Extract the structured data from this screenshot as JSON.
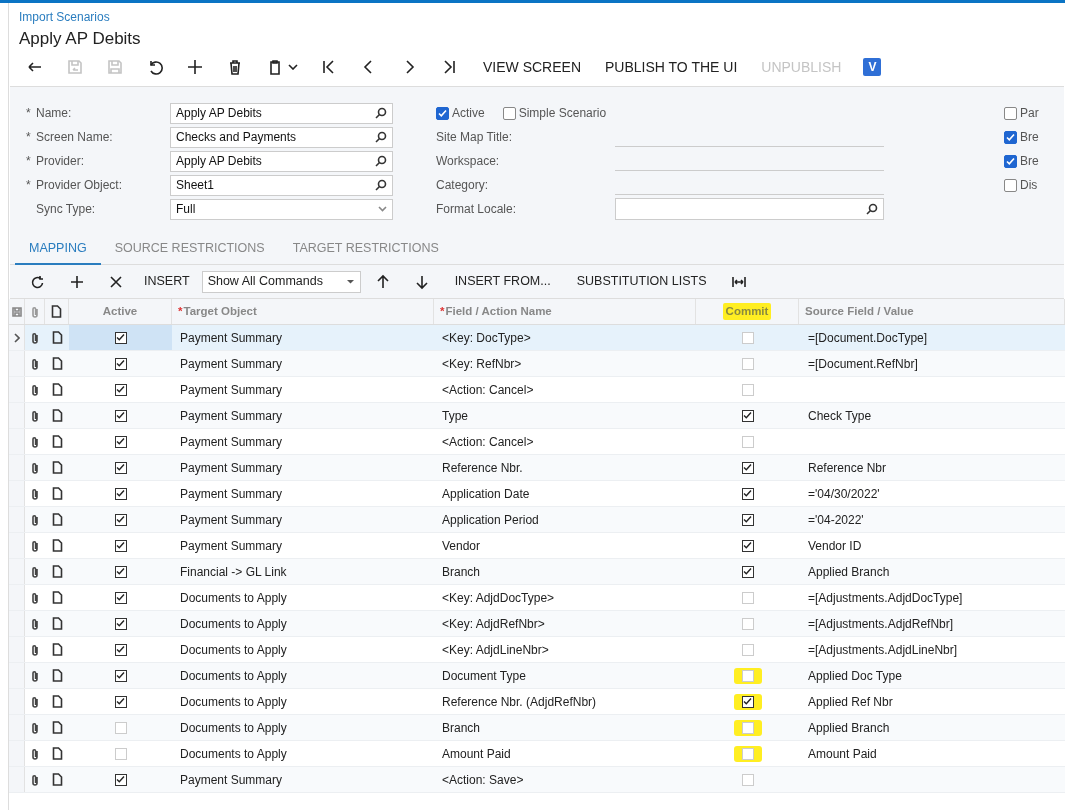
{
  "breadcrumb": "Import Scenarios",
  "title": "Apply AP Debits",
  "toolbar": {
    "icon_buttons": [
      {
        "kind": "back",
        "disabled": false
      },
      {
        "kind": "save-close",
        "disabled": true
      },
      {
        "kind": "save",
        "disabled": true
      },
      {
        "kind": "undo",
        "disabled": false
      },
      {
        "kind": "add",
        "disabled": false
      },
      {
        "kind": "delete",
        "disabled": false
      },
      {
        "kind": "clipboard",
        "disabled": false
      },
      {
        "kind": "first",
        "disabled": false
      },
      {
        "kind": "prev",
        "disabled": false
      },
      {
        "kind": "next",
        "disabled": false
      },
      {
        "kind": "last",
        "disabled": false
      }
    ],
    "text_buttons": [
      {
        "label": "VIEW SCREEN",
        "disabled": false
      },
      {
        "label": "PUBLISH TO THE UI",
        "disabled": false
      },
      {
        "label": "UNPUBLISH",
        "disabled": true
      }
    ],
    "badge": "V"
  },
  "form": {
    "left_fields": [
      {
        "marker": "*",
        "label": "Name:",
        "value": "Apply AP Debits",
        "kind": "lookup"
      },
      {
        "marker": "*",
        "label": "Screen Name:",
        "value": "Checks and Payments",
        "kind": "lookup"
      },
      {
        "marker": "*",
        "label": "Provider:",
        "value": "Apply AP Debits",
        "kind": "lookup"
      },
      {
        "marker": "*",
        "label": "Provider Object:",
        "value": "Sheet1",
        "kind": "lookup"
      },
      {
        "label": "Sync Type:",
        "value": "Full",
        "kind": "select"
      }
    ],
    "checkboxes": [
      {
        "label": "Active",
        "checked": true
      },
      {
        "label": "Simple Scenario",
        "checked": false
      }
    ],
    "middle_fields": [
      {
        "label": "Site Map Title:",
        "kind": "line"
      },
      {
        "label": "Workspace:",
        "kind": "line"
      },
      {
        "label": "Category:",
        "kind": "line"
      },
      {
        "label": "Format Locale:",
        "kind": "lookup"
      }
    ],
    "right_checkboxes": [
      {
        "label": "Par",
        "checked": false
      },
      {
        "label": "Bre",
        "checked": true
      },
      {
        "label": "Bre",
        "checked": true
      },
      {
        "label": "Dis",
        "checked": false
      }
    ]
  },
  "tabs": [
    {
      "label": "MAPPING",
      "selected": true
    },
    {
      "label": "SOURCE RESTRICTIONS",
      "selected": false
    },
    {
      "label": "TARGET RESTRICTIONS",
      "selected": false
    }
  ],
  "grid_toolbar": {
    "insert": "INSERT",
    "filter": "Show All Commands",
    "insert_from": "INSERT FROM...",
    "substitution": "SUBSTITUTION LISTS"
  },
  "columns": [
    {
      "label": "Active",
      "highlighted": false
    },
    {
      "marker": "*",
      "label": "Target Object",
      "highlighted": false
    },
    {
      "marker": "*",
      "label": "Field / Action Name",
      "highlighted": false
    },
    {
      "label": "Commit",
      "highlighted": true
    },
    {
      "label": "Source Field / Value",
      "highlighted": false
    }
  ],
  "rows": [
    {
      "selected": true,
      "active": true,
      "target": "Payment Summary",
      "field": "<Key: DocType>",
      "commit": false,
      "commit_highlighted": false,
      "source": "=[Document.DocType]"
    },
    {
      "selected": false,
      "active": true,
      "target": "Payment Summary",
      "field": "<Key: RefNbr>",
      "commit": false,
      "commit_highlighted": false,
      "source": "=[Document.RefNbr]"
    },
    {
      "selected": false,
      "active": true,
      "target": "Payment Summary",
      "field": "<Action: Cancel>",
      "commit": false,
      "commit_highlighted": false
    },
    {
      "selected": false,
      "active": true,
      "target": "Payment Summary",
      "field": "Type",
      "commit": true,
      "commit_highlighted": false,
      "source": "Check Type"
    },
    {
      "selected": false,
      "active": true,
      "target": "Payment Summary",
      "field": "<Action: Cancel>",
      "commit": false,
      "commit_highlighted": false
    },
    {
      "selected": false,
      "active": true,
      "target": "Payment Summary",
      "field": "Reference Nbr.",
      "commit": true,
      "commit_highlighted": false,
      "source": "Reference Nbr"
    },
    {
      "selected": false,
      "active": true,
      "target": "Payment Summary",
      "field": "Application Date",
      "commit": true,
      "commit_highlighted": false,
      "source": "='04/30/2022'"
    },
    {
      "selected": false,
      "active": true,
      "target": "Payment Summary",
      "field": "Application Period",
      "commit": true,
      "commit_highlighted": false,
      "source": "='04-2022'"
    },
    {
      "selected": false,
      "active": true,
      "target": "Payment Summary",
      "field": "Vendor",
      "commit": true,
      "commit_highlighted": false,
      "source": "Vendor ID"
    },
    {
      "selected": false,
      "active": true,
      "target": "Financial -> GL Link",
      "field": "Branch",
      "commit": true,
      "commit_highlighted": false,
      "source": "Applied Branch"
    },
    {
      "selected": false,
      "active": true,
      "target": "Documents to Apply",
      "field": "<Key: AdjdDocType>",
      "commit": false,
      "commit_highlighted": false,
      "source": "=[Adjustments.AdjdDocType]"
    },
    {
      "selected": false,
      "active": true,
      "target": "Documents to Apply",
      "field": "<Key: AdjdRefNbr>",
      "commit": false,
      "commit_highlighted": false,
      "source": "=[Adjustments.AdjdRefNbr]"
    },
    {
      "selected": false,
      "active": true,
      "target": "Documents to Apply",
      "field": "<Key: AdjdLineNbr>",
      "commit": false,
      "commit_highlighted": false,
      "source": "=[Adjustments.AdjdLineNbr]"
    },
    {
      "selected": false,
      "active": true,
      "target": "Documents to Apply",
      "field": "Document Type",
      "commit": false,
      "commit_highlighted": true,
      "source": "Applied Doc Type"
    },
    {
      "selected": false,
      "active": true,
      "target": "Documents to Apply",
      "field": "Reference Nbr. (AdjdRefNbr)",
      "commit": true,
      "commit_highlighted": true,
      "source": "Applied Ref Nbr"
    },
    {
      "selected": false,
      "active": false,
      "target": "Documents to Apply",
      "field": "Branch",
      "commit": false,
      "commit_highlighted": true,
      "source": "Applied Branch"
    },
    {
      "selected": false,
      "active": false,
      "target": "Documents to Apply",
      "field": "Amount Paid",
      "commit": false,
      "commit_highlighted": true,
      "source": "Amount Paid"
    },
    {
      "selected": false,
      "active": true,
      "target": "Payment Summary",
      "field": "<Action: Save>",
      "commit": false,
      "commit_highlighted": false
    }
  ]
}
